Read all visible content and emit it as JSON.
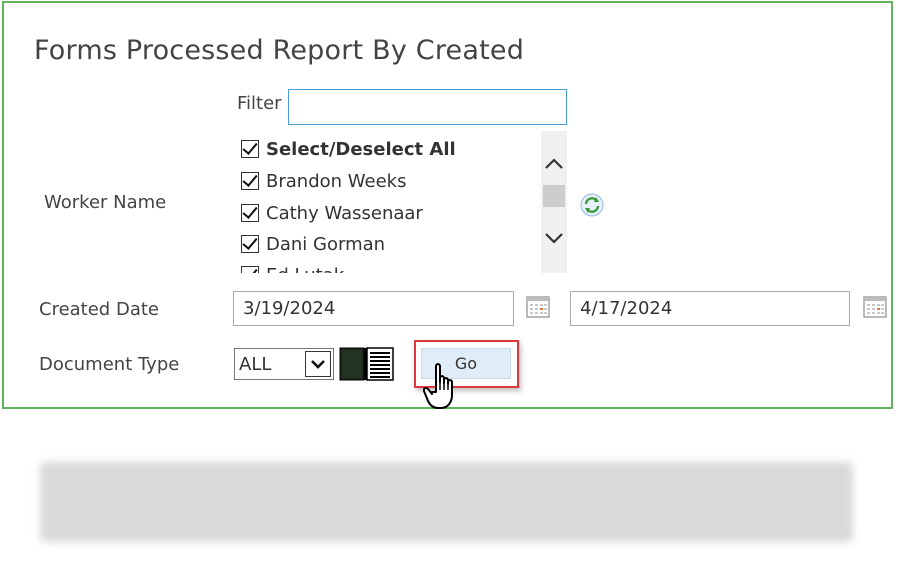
{
  "report": {
    "title": "Forms Processed Report By Created"
  },
  "filter": {
    "label": "Filter",
    "value": ""
  },
  "worker": {
    "label": "Worker Name",
    "items": [
      {
        "label": "Select/Deselect All",
        "checked": true,
        "bold": true
      },
      {
        "label": "Brandon Weeks",
        "checked": true
      },
      {
        "label": "Cathy Wassenaar",
        "checked": true
      },
      {
        "label": "Dani Gorman",
        "checked": true
      },
      {
        "label": "Ed Lutak",
        "checked": true
      }
    ]
  },
  "created_date": {
    "label": "Created Date",
    "start": "3/19/2024",
    "end": "4/17/2024"
  },
  "document_type": {
    "label": "Document Type",
    "selected": "ALL"
  },
  "actions": {
    "go_label": "Go"
  },
  "colors": {
    "panel_border": "#62b15d",
    "filter_border": "#4a9fd8",
    "highlight_border": "#e0363d",
    "go_button_bg": "#deedf7"
  },
  "icons": {
    "refresh": "refresh-icon",
    "calendar": "calendar-icon",
    "book": "book-icon",
    "cursor": "hand-pointer-icon"
  }
}
